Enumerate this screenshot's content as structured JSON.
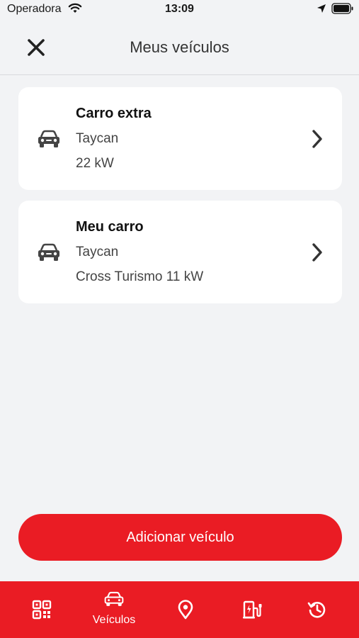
{
  "status_bar": {
    "carrier": "Operadora",
    "time": "13:09",
    "icons": [
      "wifi-icon",
      "location-icon",
      "battery-icon"
    ]
  },
  "header": {
    "title": "Meus veículos",
    "close_icon": "close-icon"
  },
  "vehicles": [
    {
      "name": "Carro extra",
      "model": "Taycan",
      "variant": "22 kW",
      "icon": "car-icon"
    },
    {
      "name": "Meu carro",
      "model": "Taycan",
      "variant": "Cross Turismo 11 kW",
      "icon": "car-icon"
    }
  ],
  "actions": {
    "add_vehicle_label": "Adicionar veículo"
  },
  "tab_bar": {
    "tabs": [
      {
        "id": "qr",
        "icon": "qr-code-icon",
        "label": ""
      },
      {
        "id": "vehicles",
        "icon": "car-icon",
        "label": "Veículos",
        "active": true
      },
      {
        "id": "map",
        "icon": "map-pin-icon",
        "label": ""
      },
      {
        "id": "charger",
        "icon": "charging-station-icon",
        "label": ""
      },
      {
        "id": "history",
        "icon": "history-icon",
        "label": ""
      }
    ]
  },
  "colors": {
    "accent": "#ea1c24",
    "background": "#f2f3f5",
    "card": "#ffffff"
  }
}
